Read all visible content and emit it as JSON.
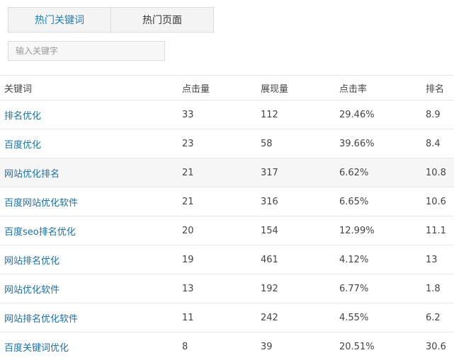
{
  "tabs": [
    {
      "label": "热门关键词",
      "active": true
    },
    {
      "label": "热门页面",
      "active": false
    }
  ],
  "search": {
    "placeholder": "输入关键字",
    "value": ""
  },
  "table": {
    "headers": [
      "关键词",
      "点击量",
      "展现量",
      "点击率",
      "排名"
    ],
    "rows": [
      {
        "keyword": "排名优化",
        "clicks": "33",
        "impressions": "112",
        "ctr": "29.46%",
        "rank": "8.9",
        "shaded": false
      },
      {
        "keyword": "百度优化",
        "clicks": "23",
        "impressions": "58",
        "ctr": "39.66%",
        "rank": "8.4",
        "shaded": false
      },
      {
        "keyword": "网站优化排名",
        "clicks": "21",
        "impressions": "317",
        "ctr": "6.62%",
        "rank": "10.8",
        "shaded": true
      },
      {
        "keyword": "百度网站优化软件",
        "clicks": "21",
        "impressions": "316",
        "ctr": "6.65%",
        "rank": "10.6",
        "shaded": false
      },
      {
        "keyword": "百度seo排名优化",
        "clicks": "20",
        "impressions": "154",
        "ctr": "12.99%",
        "rank": "11.1",
        "shaded": false
      },
      {
        "keyword": "网站排名优化",
        "clicks": "19",
        "impressions": "461",
        "ctr": "4.12%",
        "rank": "13",
        "shaded": false
      },
      {
        "keyword": "网站优化软件",
        "clicks": "13",
        "impressions": "192",
        "ctr": "6.77%",
        "rank": "1.8",
        "shaded": false
      },
      {
        "keyword": "网站排名优化软件",
        "clicks": "11",
        "impressions": "242",
        "ctr": "4.55%",
        "rank": "6.2",
        "shaded": false
      },
      {
        "keyword": "百度关键词优化",
        "clicks": "8",
        "impressions": "39",
        "ctr": "20.51%",
        "rank": "30.6",
        "shaded": false
      }
    ]
  },
  "colors": {
    "link": "#1a6fa8",
    "active_tab": "#1a7fb5",
    "border": "#dcdcdc"
  }
}
